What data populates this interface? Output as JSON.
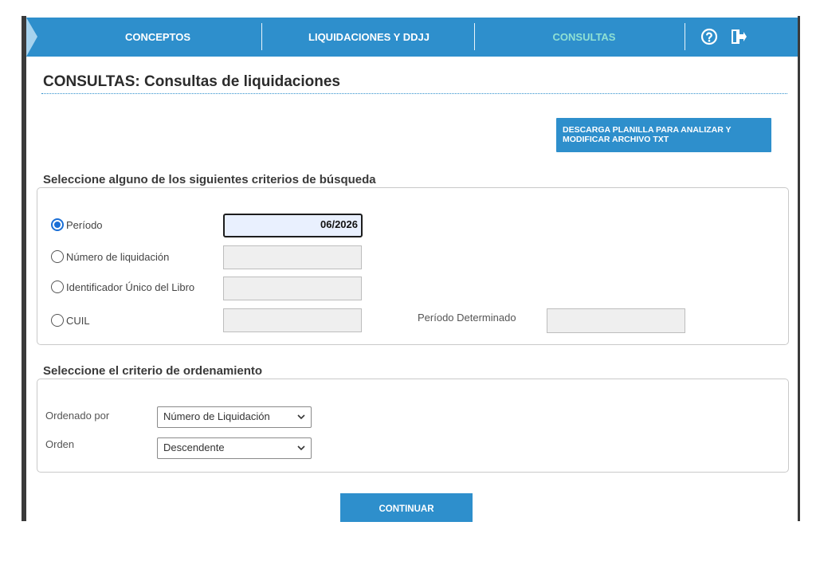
{
  "nav": {
    "items": [
      {
        "label": "CONCEPTOS",
        "active": false
      },
      {
        "label": "LIQUIDACIONES Y DDJJ",
        "active": false
      },
      {
        "label": "CONSULTAS",
        "active": true
      }
    ],
    "icons": [
      "help-circle-icon",
      "logout-icon"
    ]
  },
  "page": {
    "title": "CONSULTAS: Consultas de liquidaciones",
    "download_button": "DESCARGA PLANILLA PARA ANALIZAR Y MODIFICAR ARCHIVO TXT"
  },
  "search": {
    "legend": "Seleccione alguno de los siguientes criterios de búsqueda",
    "options": [
      {
        "label": "Período",
        "checked": true,
        "value": "06/2026"
      },
      {
        "label": "Número de liquidación",
        "checked": false,
        "value": ""
      },
      {
        "label": "Identificador Único del Libro",
        "checked": false,
        "value": ""
      },
      {
        "label": "CUIL",
        "checked": false,
        "value": ""
      }
    ],
    "periodo_determinado_label": "Período Determinado",
    "periodo_determinado_value": ""
  },
  "sort": {
    "legend": "Seleccione el criterio de ordenamiento",
    "ordenado_por_label": "Ordenado por",
    "ordenado_por_value": "Número de Liquidación",
    "orden_label": "Orden",
    "orden_value": "Descendente"
  },
  "continue_button": "CONTINUAR",
  "colors": {
    "primary": "#2e8fcc",
    "active_nav": "#8fe0d3",
    "radio": "#1b6fd6"
  }
}
